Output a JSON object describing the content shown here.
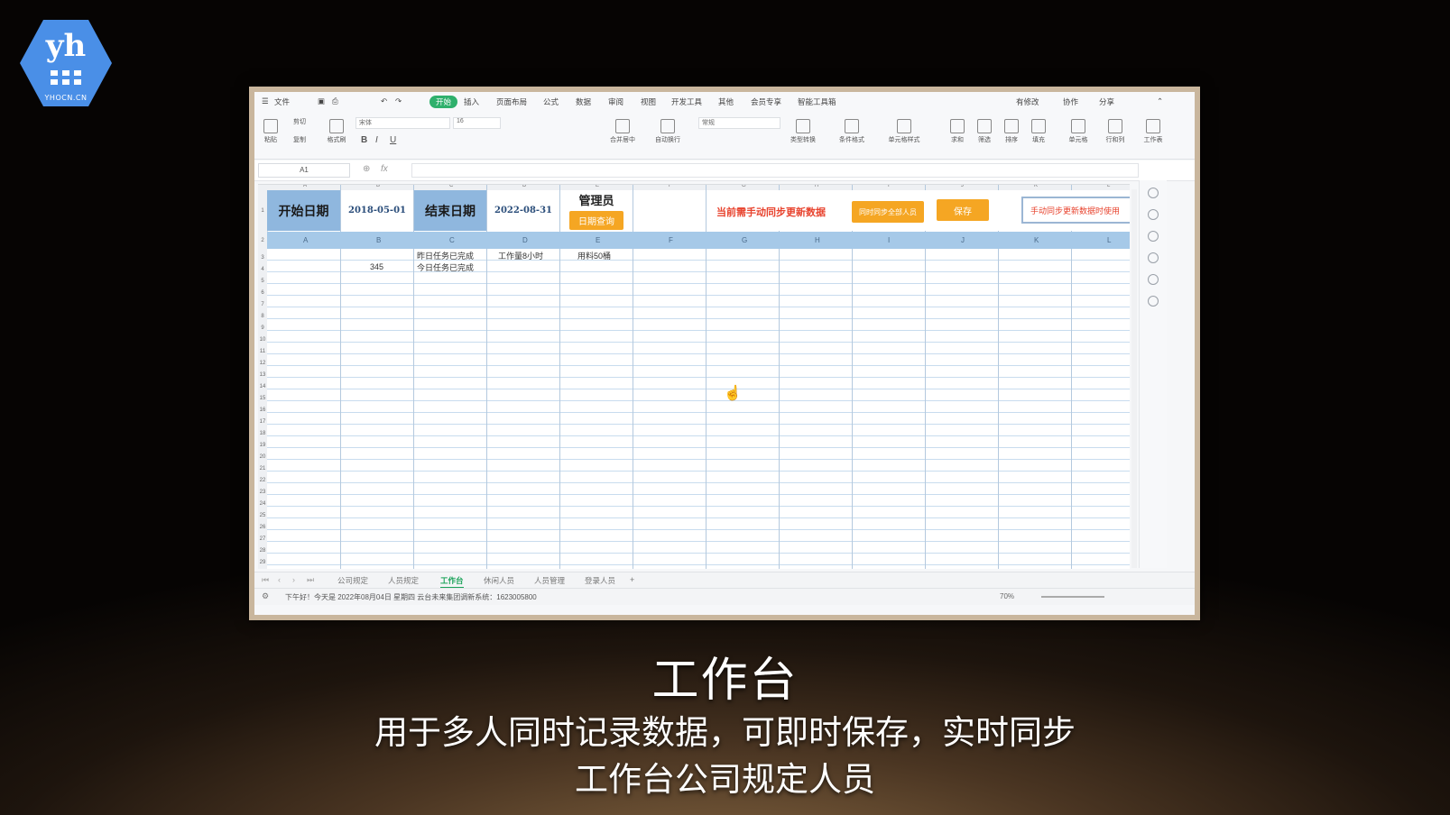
{
  "logo": {
    "text": "yh",
    "sub": "YHOCN.CN",
    "color": "#4a8fe7"
  },
  "window": {
    "menu": [
      "文件",
      "开始",
      "插入",
      "页面布局",
      "公式",
      "数据",
      "审阅",
      "视图",
      "开发工具",
      "其他",
      "会员专享",
      "智能工具箱"
    ],
    "active_menu": "开始",
    "right_actions": [
      "有修改",
      "协作",
      "分享"
    ],
    "font_name": "宋体",
    "font_size": "16",
    "number_format": "常规",
    "ribbon_labels": [
      "粘贴",
      "剪切",
      "复制",
      "格式刷",
      "合并居中",
      "自动换行",
      "类型转换",
      "条件格式",
      "单元格样式",
      "求和",
      "筛选",
      "排序",
      "填充",
      "单元格",
      "行和列",
      "工作表"
    ]
  },
  "formula_bar": {
    "cell_ref": "A1",
    "fx": "fx"
  },
  "sheet": {
    "start_label": "开始日期",
    "start_date": "2018-05-01",
    "end_label": "结束日期",
    "end_date": "2022-08-31",
    "admin_label": "管理员",
    "date_query_button": "日期查询",
    "sync_notice": "当前需手动同步更新数据",
    "sync_button": "同时同步全部人员",
    "save_button": "保存",
    "callout": "手动同步更新数据时使用",
    "columns": [
      "A",
      "B",
      "C",
      "D",
      "E",
      "F",
      "G",
      "H",
      "I",
      "J",
      "K",
      "L"
    ],
    "cells": {
      "c3": "昨日任务已完成",
      "c4": "今日任务已完成",
      "d3": "工作量8小时",
      "e3": "用料50桶",
      "b4": "345"
    }
  },
  "sheet_tabs": [
    "公司规定",
    "人员规定",
    "工作台",
    "休闲人员",
    "人员管理",
    "登录人员"
  ],
  "active_tab": "工作台",
  "status_text": "下午好！今天是 2022年08月04日 星期四 云台未来集团调新系统：1623005800",
  "zoom": "70%",
  "caption": {
    "title": "工作台",
    "line1": "用于多人同时记录数据，可即时保存，实时同步",
    "line2": "工作台公司规定人员"
  }
}
